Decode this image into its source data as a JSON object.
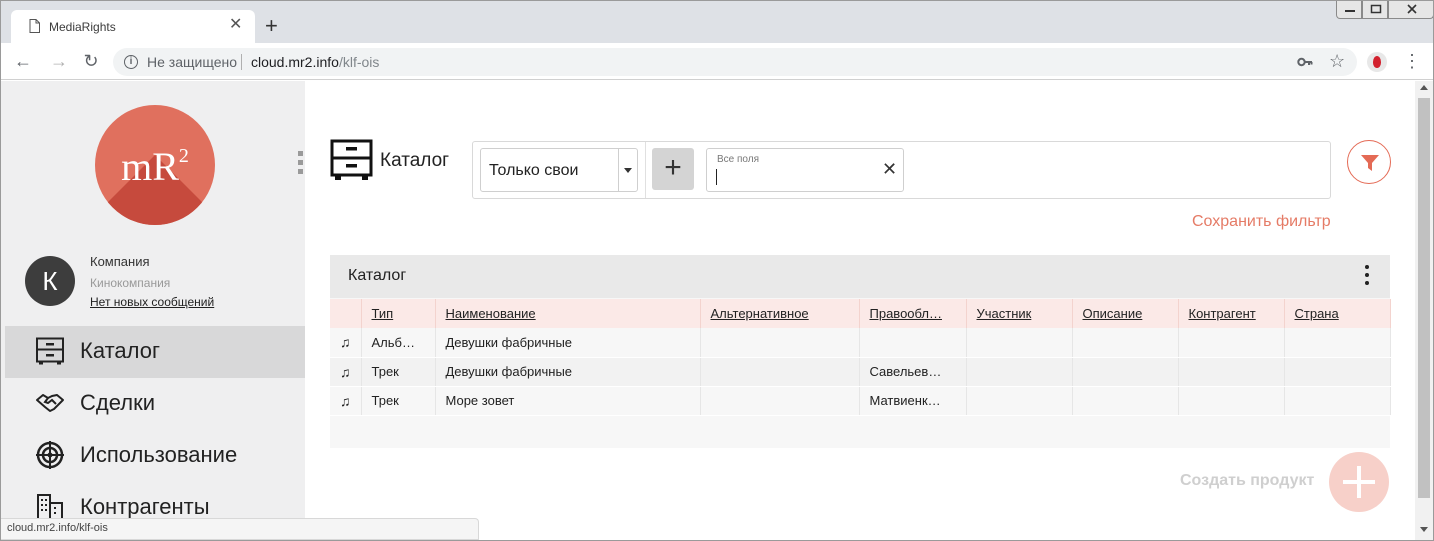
{
  "browser": {
    "tab_title": "MediaRights",
    "tab_close": "✕",
    "new_tab": "+",
    "insecure_label": "Не защищено",
    "url_host": "cloud.mr2.info",
    "url_path": "/klf-ois",
    "status_url": "cloud.mr2.info/klf-ois"
  },
  "sidebar": {
    "logo_text": "mR",
    "logo_sup": "2",
    "avatar_letter": "К",
    "company_name": "Компания",
    "company_type": "Кинокомпания",
    "messages": "Нет новых сообщений",
    "items": [
      {
        "label": "Каталог",
        "icon": "cabinet-icon",
        "active": true
      },
      {
        "label": "Сделки",
        "icon": "handshake-icon",
        "active": false
      },
      {
        "label": "Использование",
        "icon": "target-icon",
        "active": false
      },
      {
        "label": "Контрагенты",
        "icon": "building-icon",
        "active": false
      }
    ]
  },
  "main": {
    "title": "Каталог",
    "filter": {
      "select_value": "Только свои",
      "add_label": "+",
      "search_label": "Все поля",
      "search_value": "",
      "clear_label": "✕"
    },
    "save_filter": "Сохранить фильтр",
    "card_title": "Каталог",
    "columns": [
      "",
      "Тип",
      "Наименование",
      "Альтернативное",
      "Правообл…",
      "Участник",
      "Описание",
      "Контрагент",
      "Страна"
    ],
    "rows": [
      {
        "icon": "♫",
        "type": "Альб…",
        "name": "Девушки фабричные",
        "alt": "",
        "owner": "",
        "participant": "",
        "description": "",
        "contractor": "",
        "country": ""
      },
      {
        "icon": "♫",
        "type": "Трек",
        "name": "Девушки фабричные",
        "alt": "",
        "owner": "Савельев…",
        "participant": "",
        "description": "",
        "contractor": "",
        "country": ""
      },
      {
        "icon": "♫",
        "type": "Трек",
        "name": "Море зовет",
        "alt": "",
        "owner": "Матвиенк…",
        "participant": "",
        "description": "",
        "contractor": "",
        "country": ""
      }
    ],
    "create_label": "Создать продукт"
  },
  "colors": {
    "accent": "#e46a55",
    "logo": "#e0705e",
    "header_row": "#fbe9e7",
    "fab": "#f7d0c9"
  }
}
